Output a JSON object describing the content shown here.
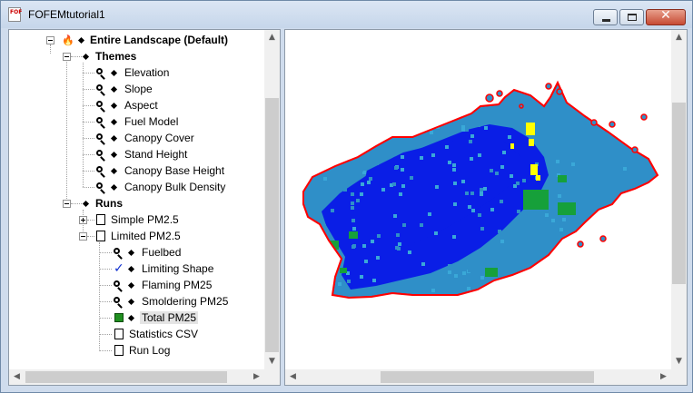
{
  "window": {
    "title": "FOFEMtutorial1",
    "app_icon_text": "FOF"
  },
  "tree": {
    "root": {
      "label": "Entire Landscape (Default)",
      "icon": "fire-icon"
    },
    "themes": {
      "label": "Themes"
    },
    "theme_items": [
      {
        "label": "Elevation",
        "icon": "magnifier-icon"
      },
      {
        "label": "Slope",
        "icon": "magnifier-icon"
      },
      {
        "label": "Aspect",
        "icon": "magnifier-icon"
      },
      {
        "label": "Fuel Model",
        "icon": "magnifier-icon"
      },
      {
        "label": "Canopy Cover",
        "icon": "magnifier-icon"
      },
      {
        "label": "Stand Height",
        "icon": "magnifier-icon"
      },
      {
        "label": "Canopy Base Height",
        "icon": "magnifier-icon"
      },
      {
        "label": "Canopy Bulk Density",
        "icon": "magnifier-icon"
      }
    ],
    "runs": {
      "label": "Runs"
    },
    "run_items": [
      {
        "label": "Simple PM2.5",
        "icon": "document-icon",
        "expanded": false
      },
      {
        "label": "Limited PM2.5",
        "icon": "document-icon",
        "expanded": true
      }
    ],
    "limited_children": [
      {
        "label": "Fuelbed",
        "icon": "magnifier-icon"
      },
      {
        "label": "Limiting Shape",
        "icon": "checkmark-icon"
      },
      {
        "label": "Flaming PM25",
        "icon": "magnifier-icon"
      },
      {
        "label": "Smoldering PM25",
        "icon": "magnifier-icon"
      },
      {
        "label": "Total PM25",
        "icon": "green-swatch-icon",
        "selected": true
      },
      {
        "label": "Statistics CSV",
        "icon": "document-icon"
      },
      {
        "label": "Run Log",
        "icon": "document-icon"
      }
    ]
  },
  "colors": {
    "fill_primary": "#0a1ee6",
    "fill_secondary": "#2f8fc8",
    "fill_light": "#3aa8d8",
    "fill_green": "#16a03a",
    "fill_yellow": "#ffff00",
    "boundary": "#ff0000",
    "selection": "#e4e4e4"
  }
}
